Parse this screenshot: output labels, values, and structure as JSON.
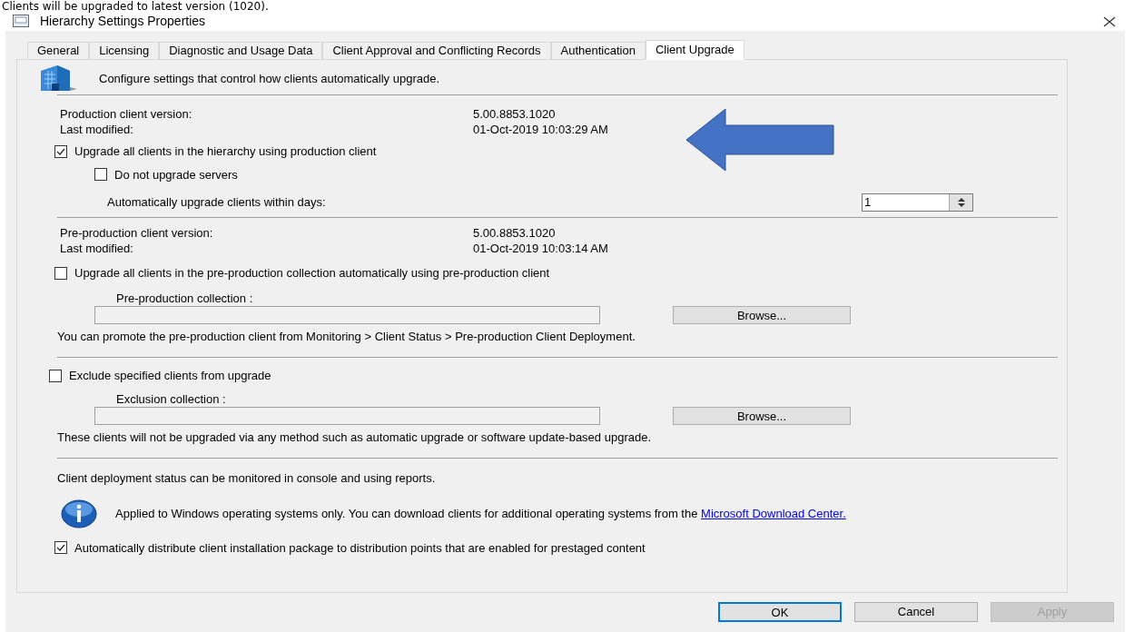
{
  "caption": "Clients will be upgraded to latest version (1020).",
  "window": {
    "title": "Hierarchy Settings Properties"
  },
  "tabs": [
    {
      "label": "General",
      "selected": false
    },
    {
      "label": "Licensing",
      "selected": false
    },
    {
      "label": "Diagnostic and Usage Data",
      "selected": false
    },
    {
      "label": "Client Approval and Conflicting Records",
      "selected": false
    },
    {
      "label": "Authentication",
      "selected": false
    },
    {
      "label": "Client Upgrade",
      "selected": true
    }
  ],
  "header": "Configure settings that control how clients automatically upgrade.",
  "production": {
    "version_label": "Production client version:",
    "version": "5.00.8853.1020",
    "modified_label": "Last modified:",
    "modified": "01-Oct-2019 10:03:29 AM"
  },
  "upgrade_all": {
    "label": "Upgrade all clients in the hierarchy using production client",
    "checked": true
  },
  "no_servers": {
    "label": "Do not upgrade servers",
    "checked": false
  },
  "days": {
    "label": "Automatically upgrade clients within days:",
    "value": "1"
  },
  "preproduction": {
    "version_label": "Pre-production client version:",
    "version": "5.00.8853.1020",
    "modified_label": "Last modified:",
    "modified": "01-Oct-2019 10:03:14 AM"
  },
  "upgrade_pre": {
    "label": "Upgrade all clients in the pre-production collection automatically using pre-production client",
    "checked": false
  },
  "pre_collection": {
    "label": "Pre-production collection :",
    "button": "Browse..."
  },
  "promote_note": "You can promote the pre-production client from Monitoring > Client Status > Pre-production Client Deployment.",
  "exclude": {
    "label": "Exclude specified clients from upgrade",
    "checked": false
  },
  "exclusion_collection": {
    "label": "Exclusion collection :",
    "button": "Browse..."
  },
  "exclude_note": "These clients will not be upgraded via any method such as automatic upgrade or software update-based upgrade.",
  "status_note": "Client deployment status can be monitored in console and using reports.",
  "info": {
    "text": "Applied to Windows operating systems only. You can download clients for additional operating systems from the",
    "link": "Microsoft Download Center."
  },
  "distribute": {
    "label": "Automatically distribute client installation package to distribution points that are enabled for prestaged content",
    "checked": true
  },
  "buttons": [
    {
      "label": "OK",
      "kind": "default",
      "disabled": false
    },
    {
      "label": "Cancel",
      "kind": "normal",
      "disabled": false
    },
    {
      "label": "Apply",
      "kind": "normal",
      "disabled": true
    }
  ]
}
